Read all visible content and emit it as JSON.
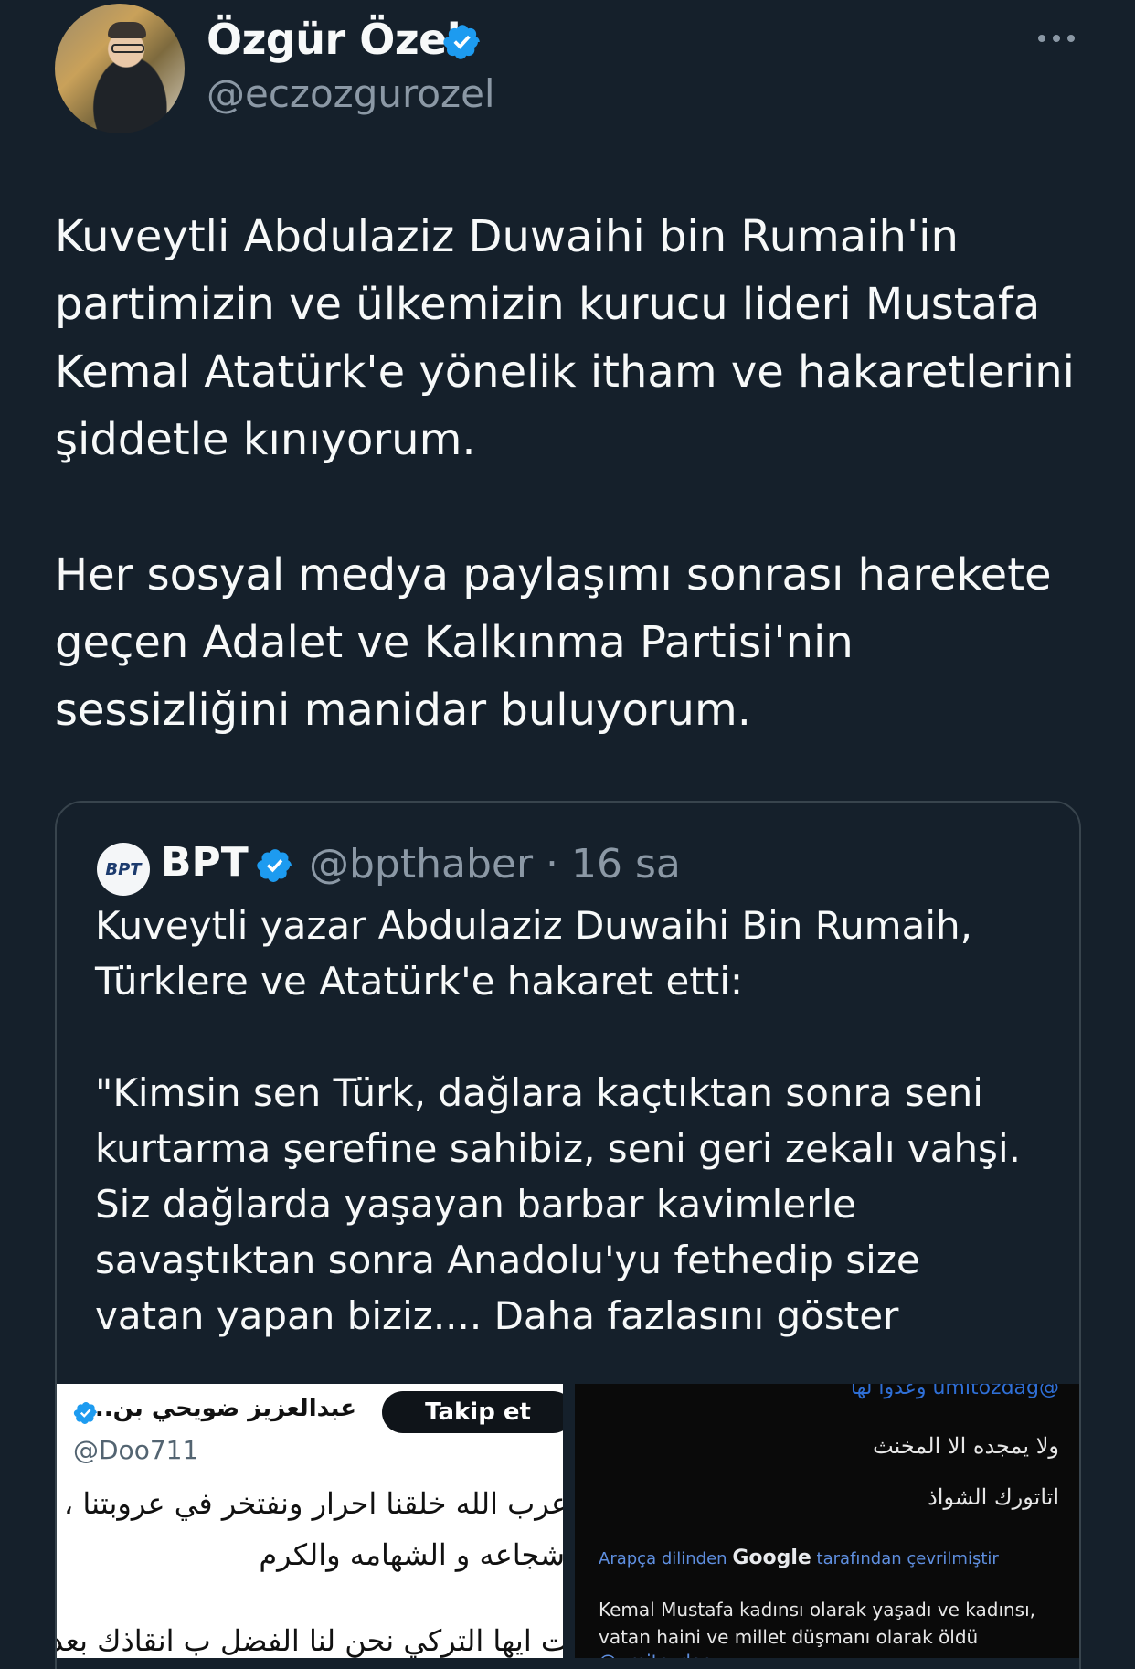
{
  "tweet": {
    "author_name": "Özgür Özel",
    "author_handle": "@eczozgurozel",
    "more_icon": "more-horizontal-icon",
    "verified_color": "#1d9bf0",
    "text": "Kuveytli Abdulaziz Duwaihi bin Rumaih'in\npartimizin ve ülkemizin kurucu lideri Mustafa\nKemal Atatürk'e yönelik itham ve hakaretlerini\nşiddetle kınıyorum.\n\nHer sosyal medya paylaşımı sonrası harekete\ngeçen Adalet ve Kalkınma Partisi'nin\nsessizliğini manidar buluyorum."
  },
  "quote": {
    "avatar_text": "BPT",
    "author_name": "BPT",
    "author_handle": "@bpthaber · 16 sa",
    "text": "Kuveytli yazar Abdulaziz Duwaihi Bin Rumaih,\nTürklere ve Atatürk'e hakaret etti:\n\n\"Kimsin sen Türk, dağlara kaçtıktan sonra seni\nkurtarma şerefine sahibiz, seni geri zekalı vahşi.\nSiz dağlarda yaşayan barbar kavimlerle\nsavaştıktan sonra Anadolu'yu fethedip size\nvatan yapan biziz.... Daha fazlasını göster",
    "images": {
      "left": {
        "name": "عبدالعزيز ضويحي بن...",
        "handle": "@Doo711",
        "follow_label": "Takip et",
        "lines": [
          "عرب الله خلقنا احرار ونفتخر في عروبتنا ،",
          "شجاعه و الشهامه والكرم",
          "ت ايها التركي نحن لنا الفضل ب انقاذك بعد"
        ]
      },
      "right": {
        "top_line": "@umitozdag وعدوا لها",
        "ar_lines": [
          "ولا يمجده الا المخنث",
          "اتاتورك الشواذ"
        ],
        "translate_prefix": "Arapça dilinden",
        "translate_brand": "Google",
        "translate_suffix": "tarafından çevrilmiştir",
        "translation": "Kemal Mustafa kadınsı olarak yaşadı ve kadınsı,\nvatan haini ve millet düşmanı olarak öldü",
        "mention": "@umitozdag"
      }
    }
  }
}
